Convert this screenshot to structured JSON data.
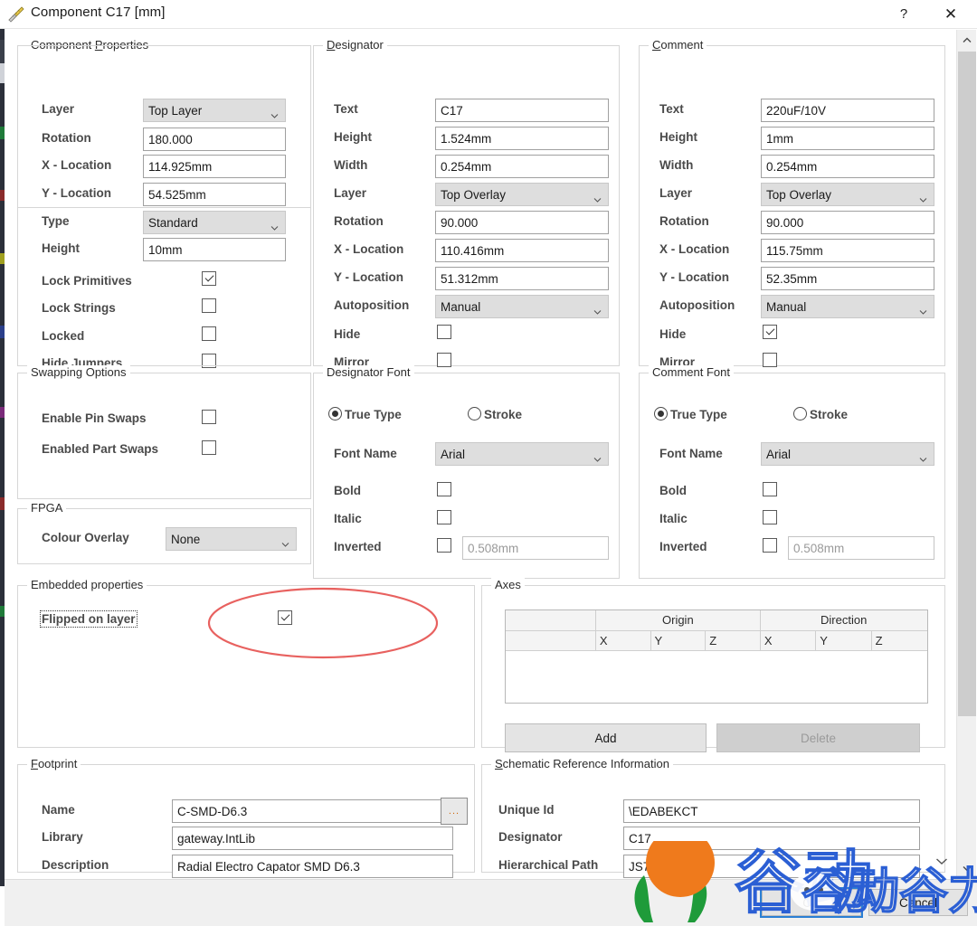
{
  "window": {
    "title": "Component C17 [mm]",
    "icon": "ruler-triangle-icon",
    "help_label": "?",
    "close_label": "✕"
  },
  "component_properties": {
    "legend": "Component Properties",
    "legend_accel": "P",
    "fields": [
      {
        "label": "Layer",
        "value": "Top Layer",
        "kind": "combo"
      },
      {
        "label": "Rotation",
        "value": "180.000",
        "kind": "text"
      },
      {
        "label": "X - Location",
        "value": "114.925mm",
        "kind": "text"
      },
      {
        "label": "Y - Location",
        "value": "54.525mm",
        "kind": "text"
      },
      {
        "label": "Type",
        "value": "Standard",
        "kind": "combo"
      },
      {
        "label": "Height",
        "value": "10mm",
        "kind": "text"
      }
    ],
    "checks": [
      {
        "label": "Lock Primitives",
        "checked": true
      },
      {
        "label": "Lock Strings",
        "checked": false
      },
      {
        "label": "Locked",
        "checked": false
      },
      {
        "label": "Hide Jumpers",
        "checked": false
      }
    ]
  },
  "designator": {
    "legend": "Designator",
    "legend_accel": "D",
    "fields": [
      {
        "label": "Text",
        "value": "C17",
        "kind": "text"
      },
      {
        "label": "Height",
        "value": "1.524mm",
        "kind": "text"
      },
      {
        "label": "Width",
        "value": "0.254mm",
        "kind": "text"
      },
      {
        "label": "Layer",
        "value": "Top Overlay",
        "kind": "combo"
      },
      {
        "label": "Rotation",
        "value": "90.000",
        "kind": "text"
      },
      {
        "label": "X - Location",
        "value": "110.416mm",
        "kind": "text"
      },
      {
        "label": "Y - Location",
        "value": "51.312mm",
        "kind": "text"
      },
      {
        "label": "Autoposition",
        "value": "Manual",
        "kind": "combo"
      }
    ],
    "checks": [
      {
        "label": "Hide",
        "checked": false
      },
      {
        "label": "Mirror",
        "checked": false
      }
    ]
  },
  "comment": {
    "legend": "Comment",
    "legend_accel": "C",
    "fields": [
      {
        "label": "Text",
        "value": "220uF/10V",
        "kind": "text"
      },
      {
        "label": "Height",
        "value": "1mm",
        "kind": "text"
      },
      {
        "label": "Width",
        "value": "0.254mm",
        "kind": "text"
      },
      {
        "label": "Layer",
        "value": "Top Overlay",
        "kind": "combo"
      },
      {
        "label": "Rotation",
        "value": "90.000",
        "kind": "text"
      },
      {
        "label": "X - Location",
        "value": "115.75mm",
        "kind": "text"
      },
      {
        "label": "Y - Location",
        "value": "52.35mm",
        "kind": "text"
      },
      {
        "label": "Autoposition",
        "value": "Manual",
        "kind": "combo"
      }
    ],
    "checks": [
      {
        "label": "Hide",
        "checked": true
      },
      {
        "label": "Mirror",
        "checked": false
      }
    ]
  },
  "swapping_options": {
    "legend": "Swapping Options",
    "checks": [
      {
        "label": "Enable Pin Swaps",
        "checked": false
      },
      {
        "label": "Enabled Part Swaps",
        "checked": false
      }
    ]
  },
  "fpga": {
    "legend": "FPGA",
    "label": "Colour Overlay",
    "value": "None"
  },
  "designator_font": {
    "legend": "Designator Font",
    "radio_truetype": "True Type",
    "radio_stroke": "Stroke",
    "selected": "True Type",
    "font_name_label": "Font Name",
    "font_name_value": "Arial",
    "checks": [
      {
        "label": "Bold",
        "checked": false
      },
      {
        "label": "Italic",
        "checked": false
      },
      {
        "label": "Inverted",
        "checked": false
      }
    ],
    "inverted_placeholder": "0.508mm"
  },
  "comment_font": {
    "legend": "Comment Font",
    "radio_truetype": "True Type",
    "radio_stroke": "Stroke",
    "selected": "True Type",
    "font_name_label": "Font Name",
    "font_name_value": "Arial",
    "checks": [
      {
        "label": "Bold",
        "checked": false
      },
      {
        "label": "Italic",
        "checked": false
      },
      {
        "label": "Inverted",
        "checked": false
      }
    ],
    "inverted_placeholder": "0.508mm"
  },
  "embedded_properties": {
    "legend": "Embedded properties",
    "label": "Flipped on layer",
    "checked": true
  },
  "axes": {
    "legend": "Axes",
    "group_headers": [
      "",
      "Origin",
      "Direction"
    ],
    "origin_label": "Origin",
    "direction_label": "Direction",
    "sub_headers": [
      "X",
      "Y",
      "Z",
      "X",
      "Y",
      "Z"
    ],
    "rows": [],
    "add_label": "Add",
    "delete_label": "Delete",
    "delete_enabled": false
  },
  "footprint": {
    "legend": "Footprint",
    "legend_accel": "F",
    "fields": [
      {
        "label": "Name",
        "value": "C-SMD-D6.3"
      },
      {
        "label": "Library",
        "value": "gateway.IntLib"
      },
      {
        "label": "Description",
        "value": "Radial Electro Capator SMD D6.3"
      }
    ],
    "browse_label": "..."
  },
  "schematic_reference": {
    "legend": "Schematic Reference Information",
    "legend_accel": "S",
    "fields": [
      {
        "label": "Unique Id",
        "value": "\\EDABEKCT"
      },
      {
        "label": "Designator",
        "value": "C17"
      },
      {
        "label": "Hierarchical Path",
        "value": "JS76x8        power"
      }
    ]
  },
  "footer": {
    "ok_label": "OK",
    "cancel_label": "Cancel"
  },
  "watermark": {
    "text": "谷动谷力",
    "text_small": "谷动谷力",
    "colors": {
      "blue": "#2b5fd4",
      "orange": "#ef7a1c",
      "green": "#1f9b3a"
    }
  },
  "annotation": {
    "shape": "ellipse",
    "color": "#e8615f"
  },
  "scrollbar": {
    "up_arrow": "⌃",
    "down_arrow": "⌄"
  }
}
